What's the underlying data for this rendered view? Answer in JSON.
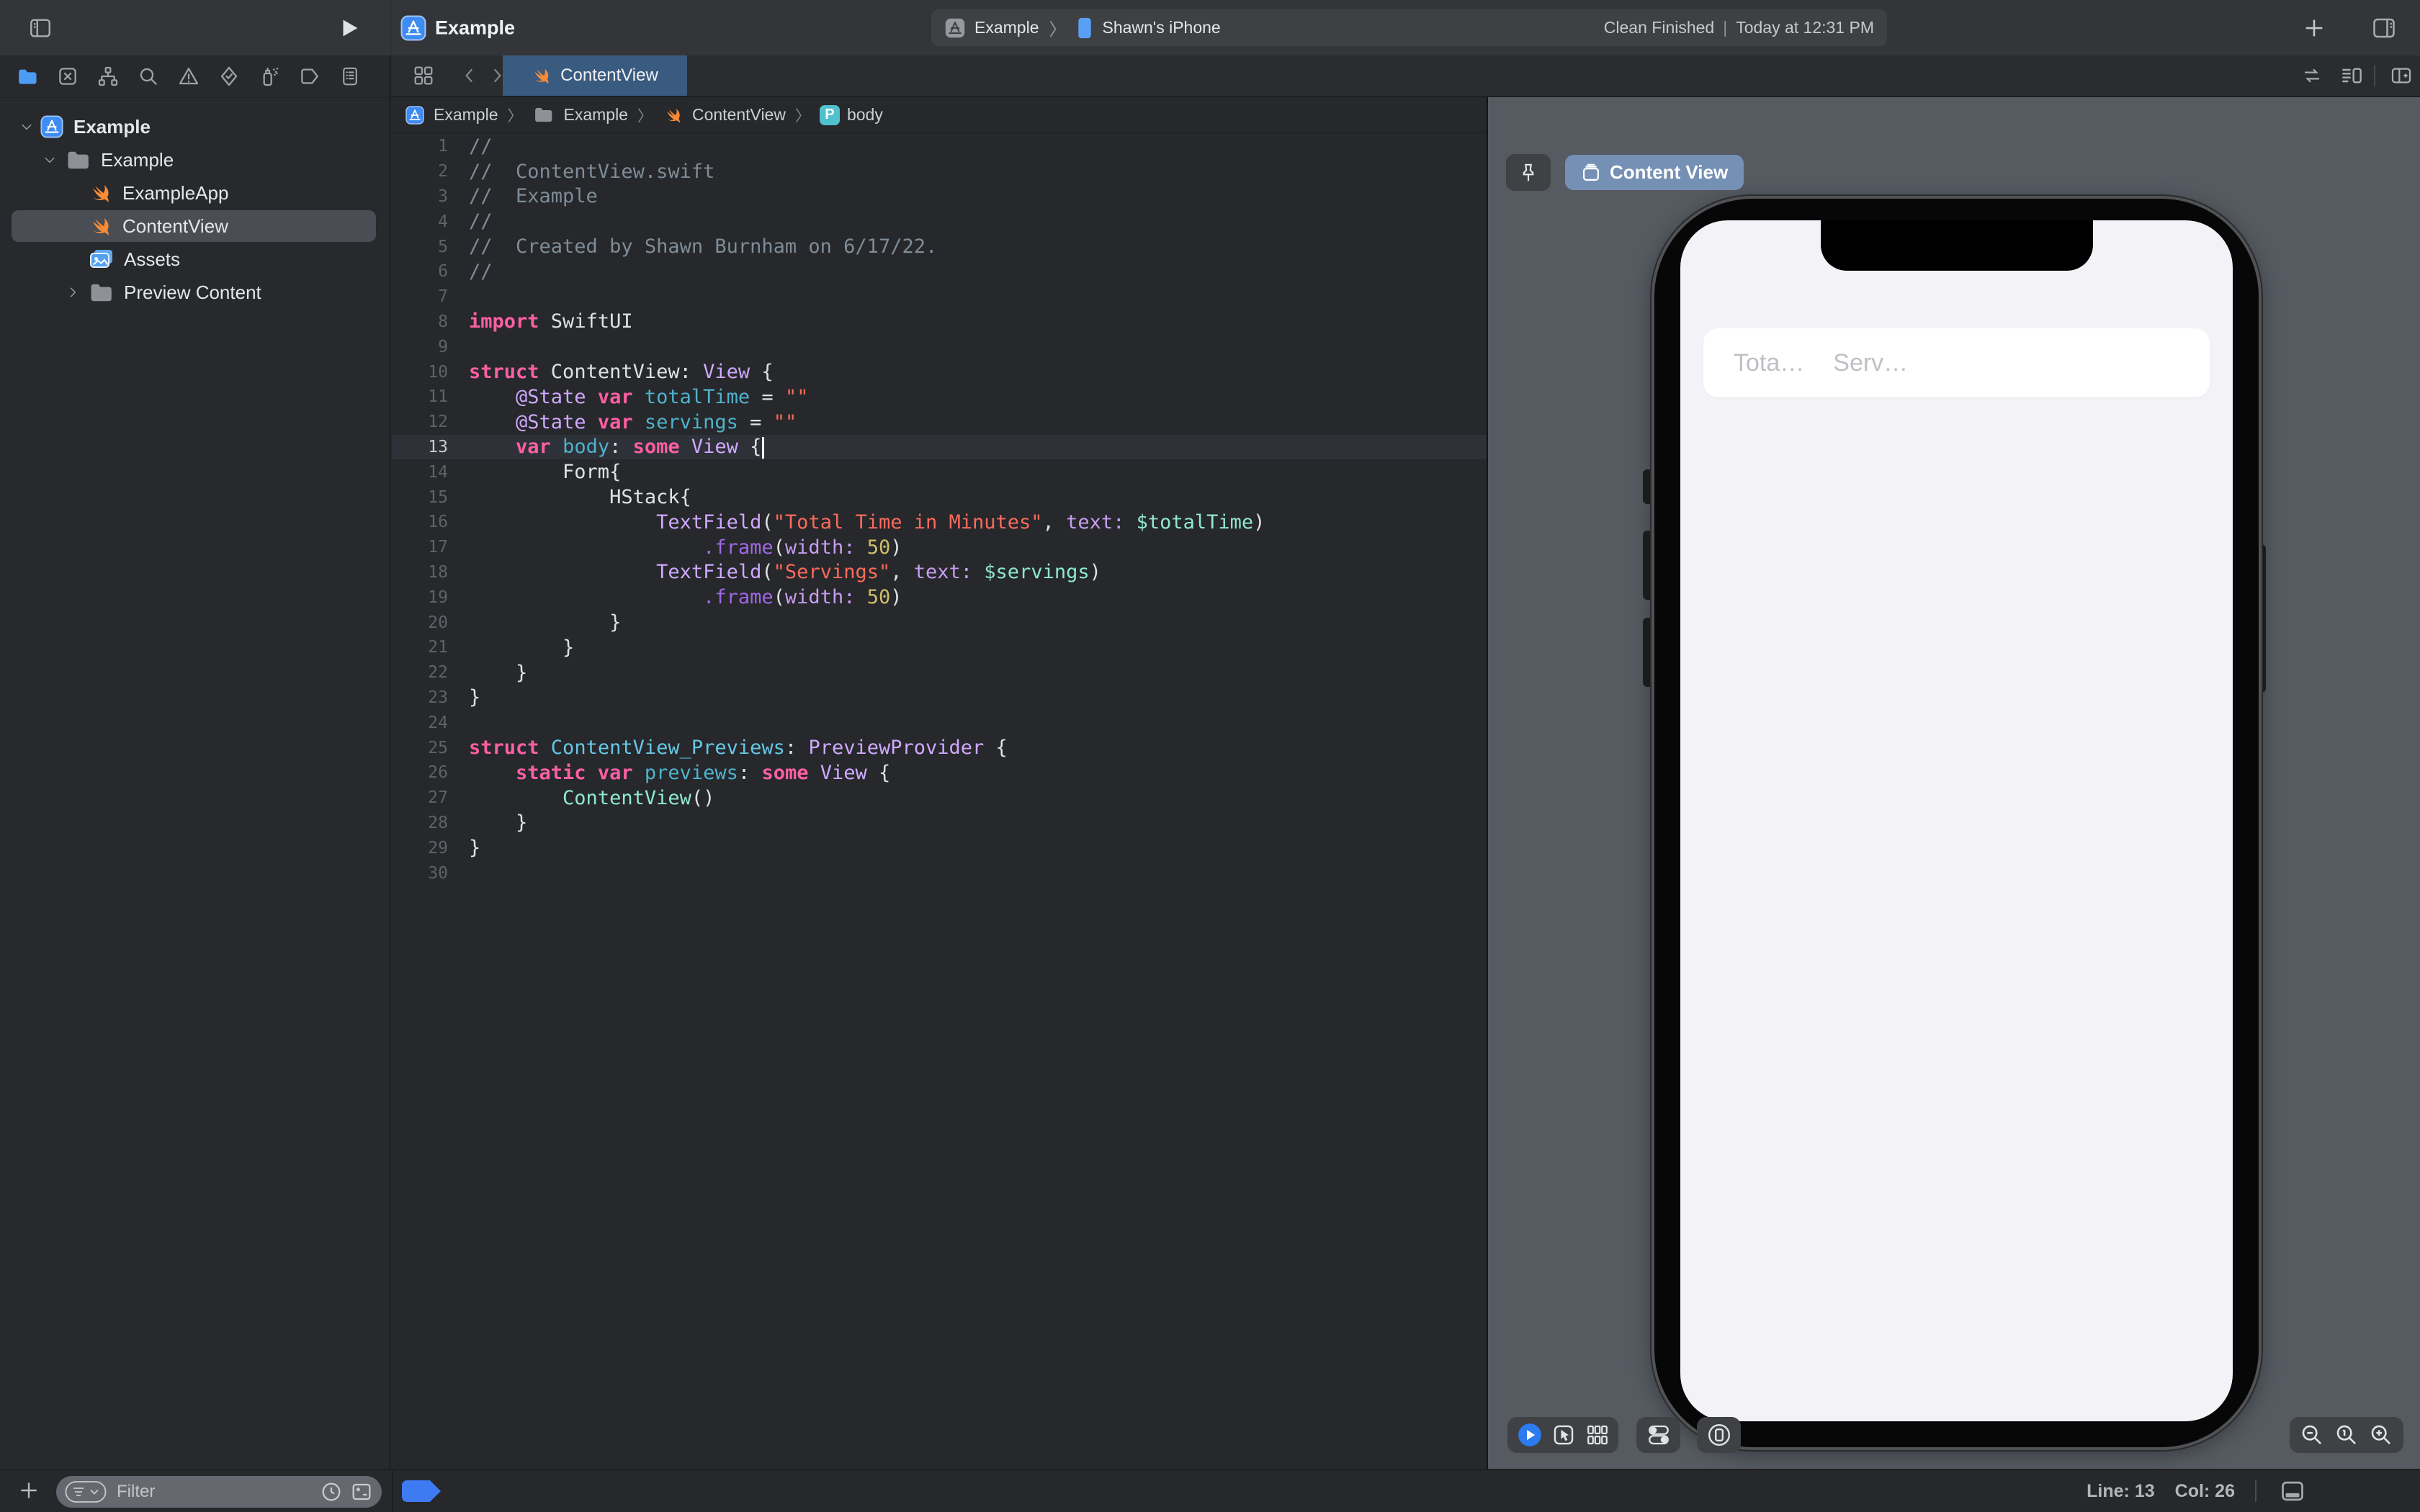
{
  "window": {
    "title": "Example"
  },
  "toolbar": {
    "scheme_app": "Example",
    "scheme_device": "Shawn's iPhone",
    "status_left": "Clean Finished",
    "status_sep": "|",
    "status_right": "Today at 12:31 PM"
  },
  "navigator": {
    "icons": [
      "project",
      "source-control",
      "symbols",
      "find",
      "issues",
      "tests",
      "debug",
      "breakpoints",
      "reports"
    ],
    "active_icon": "project",
    "tree": [
      {
        "label": "Example",
        "icon": "app",
        "depth": 0,
        "disclosure": "open",
        "bold": true
      },
      {
        "label": "Example",
        "icon": "folder",
        "depth": 1,
        "disclosure": "open"
      },
      {
        "label": "ExampleApp",
        "icon": "swift",
        "depth": 2
      },
      {
        "label": "ContentView",
        "icon": "swift",
        "depth": 2,
        "selected": true
      },
      {
        "label": "Assets",
        "icon": "assets",
        "depth": 2
      },
      {
        "label": "Preview Content",
        "icon": "folder",
        "depth": 2,
        "disclosure": "closed"
      }
    ],
    "filter_placeholder": "Filter"
  },
  "tabs": {
    "active_label": "ContentView"
  },
  "jumpbar": [
    {
      "icon": "app",
      "label": "Example"
    },
    {
      "icon": "folder",
      "label": "Example"
    },
    {
      "icon": "swift",
      "label": "ContentView"
    },
    {
      "icon": "pbadge",
      "label": "body"
    }
  ],
  "editor": {
    "current_line": 13,
    "palette": {
      "kw": "#FC5FA3",
      "cm": "#7F8C98",
      "st": "#FC6A5D",
      "nm": "#D0BF69",
      "ty": "#D0A8FF",
      "fn": "#A167E6",
      "lb": "#C79DF0",
      "dc": "#4FB2CC",
      "dn": "#66C7E6",
      "mt": "#8FE8CF",
      "pl": "#DFE1E4"
    },
    "lines": [
      [
        1,
        [
          [
            "cm",
            "//"
          ]
        ]
      ],
      [
        2,
        [
          [
            "cm",
            "//  ContentView.swift"
          ]
        ]
      ],
      [
        3,
        [
          [
            "cm",
            "//  Example"
          ]
        ]
      ],
      [
        4,
        [
          [
            "cm",
            "//"
          ]
        ]
      ],
      [
        5,
        [
          [
            "cm",
            "//  Created by Shawn Burnham on 6/17/22."
          ]
        ]
      ],
      [
        6,
        [
          [
            "cm",
            "//"
          ]
        ]
      ],
      [
        7,
        []
      ],
      [
        8,
        [
          [
            "kw",
            "import"
          ],
          [
            "pl",
            " SwiftUI"
          ]
        ]
      ],
      [
        9,
        []
      ],
      [
        10,
        [
          [
            "kw",
            "struct"
          ],
          [
            "pl",
            " ContentView: "
          ],
          [
            "ty",
            "View"
          ],
          [
            "pl",
            " {"
          ]
        ]
      ],
      [
        11,
        [
          [
            "pl",
            "    "
          ],
          [
            "ty",
            "@State"
          ],
          [
            "kw",
            " var"
          ],
          [
            "dc",
            " totalTime"
          ],
          [
            "pl",
            " = "
          ],
          [
            "st",
            "\"\""
          ]
        ]
      ],
      [
        12,
        [
          [
            "pl",
            "    "
          ],
          [
            "ty",
            "@State"
          ],
          [
            "kw",
            " var"
          ],
          [
            "dc",
            " servings"
          ],
          [
            "pl",
            " = "
          ],
          [
            "st",
            "\"\""
          ]
        ]
      ],
      [
        13,
        [
          [
            "pl",
            "    "
          ],
          [
            "kw",
            "var"
          ],
          [
            "dc",
            " body"
          ],
          [
            "pl",
            ": "
          ],
          [
            "kw",
            "some"
          ],
          [
            "ty",
            " View"
          ],
          [
            "pl",
            " {"
          ],
          [
            "caret",
            ""
          ]
        ]
      ],
      [
        14,
        [
          [
            "pl",
            "        Form{"
          ]
        ]
      ],
      [
        15,
        [
          [
            "pl",
            "            HStack{"
          ]
        ]
      ],
      [
        16,
        [
          [
            "pl",
            "                "
          ],
          [
            "ty",
            "TextField"
          ],
          [
            "pl",
            "("
          ],
          [
            "st",
            "\"Total Time in Minutes\""
          ],
          [
            "pl",
            ", "
          ],
          [
            "lb",
            "text:"
          ],
          [
            "pl",
            " "
          ],
          [
            "mt",
            "$totalTime"
          ],
          [
            "pl",
            ")"
          ]
        ]
      ],
      [
        17,
        [
          [
            "pl",
            "                    "
          ],
          [
            "fn",
            ".frame"
          ],
          [
            "pl",
            "("
          ],
          [
            "lb",
            "width:"
          ],
          [
            "pl",
            " "
          ],
          [
            "nm",
            "50"
          ],
          [
            "pl",
            ")"
          ]
        ]
      ],
      [
        18,
        [
          [
            "pl",
            "                "
          ],
          [
            "ty",
            "TextField"
          ],
          [
            "pl",
            "("
          ],
          [
            "st",
            "\"Servings\""
          ],
          [
            "pl",
            ", "
          ],
          [
            "lb",
            "text:"
          ],
          [
            "pl",
            " "
          ],
          [
            "mt",
            "$servings"
          ],
          [
            "pl",
            ")"
          ]
        ]
      ],
      [
        19,
        [
          [
            "pl",
            "                    "
          ],
          [
            "fn",
            ".frame"
          ],
          [
            "pl",
            "("
          ],
          [
            "lb",
            "width:"
          ],
          [
            "pl",
            " "
          ],
          [
            "nm",
            "50"
          ],
          [
            "pl",
            ")"
          ]
        ]
      ],
      [
        20,
        [
          [
            "pl",
            "            }"
          ]
        ]
      ],
      [
        21,
        [
          [
            "pl",
            "        }"
          ]
        ]
      ],
      [
        22,
        [
          [
            "pl",
            "    }"
          ]
        ]
      ],
      [
        23,
        [
          [
            "pl",
            "}"
          ]
        ]
      ],
      [
        24,
        []
      ],
      [
        25,
        [
          [
            "kw",
            "struct"
          ],
          [
            "dn",
            " ContentView_Previews"
          ],
          [
            "pl",
            ": "
          ],
          [
            "ty",
            "PreviewProvider"
          ],
          [
            "pl",
            " {"
          ]
        ]
      ],
      [
        26,
        [
          [
            "pl",
            "    "
          ],
          [
            "kw",
            "static"
          ],
          [
            "kw",
            " var"
          ],
          [
            "dc",
            " previews"
          ],
          [
            "pl",
            ": "
          ],
          [
            "kw",
            "some"
          ],
          [
            "ty",
            " View"
          ],
          [
            "pl",
            " {"
          ]
        ]
      ],
      [
        27,
        [
          [
            "pl",
            "        "
          ],
          [
            "mt",
            "ContentView"
          ],
          [
            "pl",
            "()"
          ]
        ]
      ],
      [
        28,
        [
          [
            "pl",
            "    }"
          ]
        ]
      ],
      [
        29,
        [
          [
            "pl",
            "}"
          ]
        ]
      ],
      [
        30,
        []
      ]
    ]
  },
  "canvas": {
    "device_button_label": "Content View",
    "placeholders": [
      "Tota…",
      "Serv…"
    ]
  },
  "statusbar": {
    "line_label": "Line: 13",
    "col_label": "Col: 26"
  }
}
